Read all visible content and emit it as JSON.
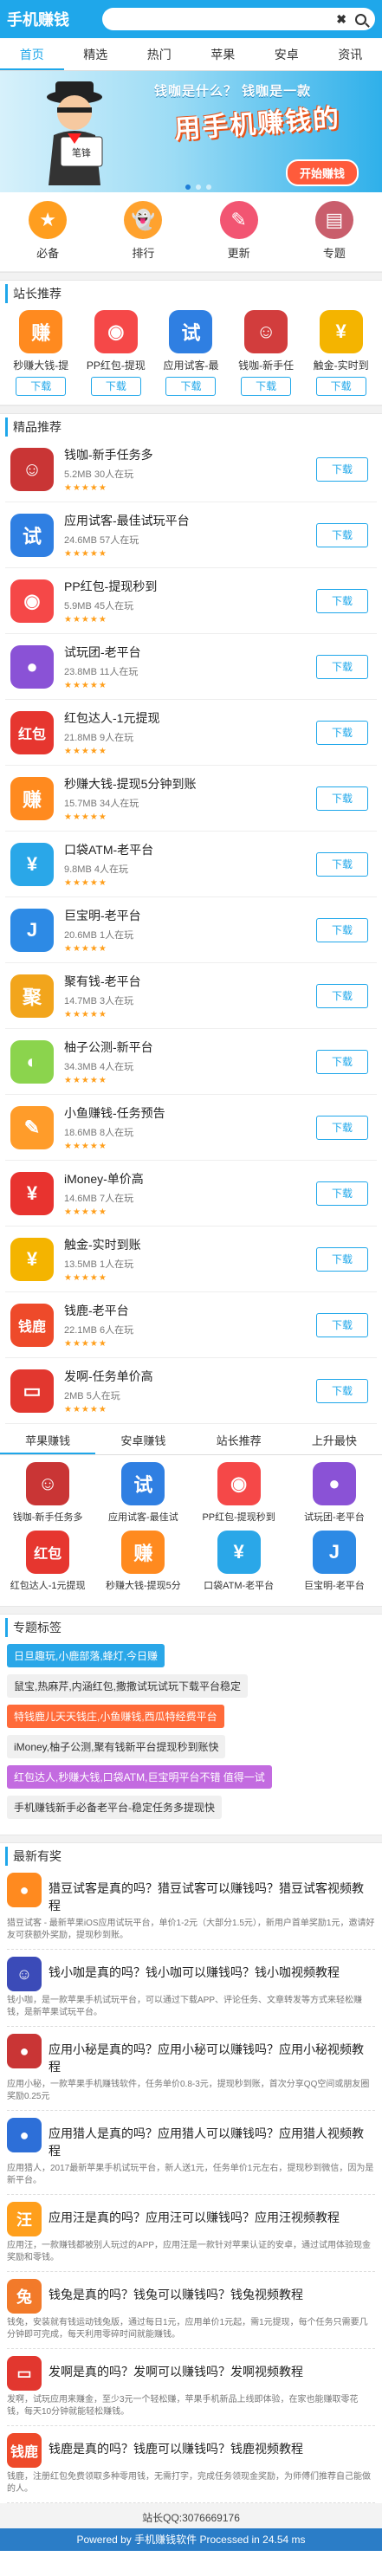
{
  "header": {
    "title": "手机赚钱",
    "search_placeholder": "",
    "clear_glyph": "✖"
  },
  "nav": [
    "首页",
    "精选",
    "热门",
    "苹果",
    "安卓",
    "资讯"
  ],
  "banner": {
    "question": "钱咖是什么？ 钱咖是一款",
    "headline": "用手机赚钱的",
    "button": "开始赚钱",
    "man_label": "笔锋"
  },
  "quick": [
    {
      "label": "必备",
      "icon": "star-icon",
      "color": "#ff9e1f",
      "glyph": "★"
    },
    {
      "label": "排行",
      "icon": "ghost-icon",
      "color": "#ffa22e",
      "glyph": "👻"
    },
    {
      "label": "更新",
      "icon": "edit-icon",
      "color": "#f25572",
      "glyph": "✎"
    },
    {
      "label": "专题",
      "icon": "folder-icon",
      "color": "#c95e6c",
      "glyph": "▤"
    }
  ],
  "recommend": {
    "title": "站长推荐",
    "download": "下载",
    "items": [
      {
        "name": "秒赚大钱-提",
        "glyph": "赚",
        "color": "#ff8a1f"
      },
      {
        "name": "PP红包-提现",
        "glyph": "◉",
        "color": "#f54848"
      },
      {
        "name": "应用试客-最",
        "glyph": "试",
        "color": "#2f7fe2"
      },
      {
        "name": "钱咖-新手任",
        "glyph": "☺",
        "color": "#d23d3d"
      },
      {
        "name": "触金-实时到",
        "glyph": "¥",
        "color": "#f4b400"
      }
    ]
  },
  "selected": {
    "title": "精品推荐",
    "download": "下载",
    "stars": "★★★★★",
    "items": [
      {
        "name": "钱咖-新手任务多",
        "size": "5.2MB",
        "users": "30人在玩",
        "glyph": "☺",
        "color": "#c93535"
      },
      {
        "name": "应用试客-最佳试玩平台",
        "size": "24.6MB",
        "users": "57人在玩",
        "glyph": "试",
        "color": "#2f7fe2"
      },
      {
        "name": "PP红包-提现秒到",
        "size": "5.9MB",
        "users": "45人在玩",
        "glyph": "◉",
        "color": "#f54848"
      },
      {
        "name": "试玩团-老平台",
        "size": "23.8MB",
        "users": "11人在玩",
        "glyph": "●",
        "color": "#8a52d6"
      },
      {
        "name": "红包达人-1元提现",
        "size": "21.8MB",
        "users": "9人在玩",
        "glyph": "红包",
        "color": "#e6362f"
      },
      {
        "name": "秒赚大钱-提现5分钟到账",
        "size": "15.7MB",
        "users": "34人在玩",
        "glyph": "赚",
        "color": "#ff8a1f"
      },
      {
        "name": "口袋ATM-老平台",
        "size": "9.8MB",
        "users": "4人在玩",
        "glyph": "¥",
        "color": "#2aa7e8"
      },
      {
        "name": "巨宝明-老平台",
        "size": "20.6MB",
        "users": "1人在玩",
        "glyph": "J",
        "color": "#2d8ae5"
      },
      {
        "name": "聚有钱-老平台",
        "size": "14.7MB",
        "users": "3人在玩",
        "glyph": "聚",
        "color": "#f2a51c"
      },
      {
        "name": "柚子公测-新平台",
        "size": "34.3MB",
        "users": "4人在玩",
        "glyph": "◐",
        "color": "#8bd44d"
      },
      {
        "name": "小鱼赚钱-任务预告",
        "size": "18.6MB",
        "users": "8人在玩",
        "glyph": "✎",
        "color": "#ff9c2a"
      },
      {
        "name": "iMoney-单价高",
        "size": "14.6MB",
        "users": "7人在玩",
        "glyph": "¥",
        "color": "#e8332f"
      },
      {
        "name": "触金-实时到账",
        "size": "13.5MB",
        "users": "1人在玩",
        "glyph": "¥",
        "color": "#f4b400"
      },
      {
        "name": "钱鹿-老平台",
        "size": "22.1MB",
        "users": "6人在玩",
        "glyph": "钱鹿",
        "color": "#ee4a2a"
      },
      {
        "name": "发啊-任务单价高",
        "size": "2MB",
        "users": "5人在玩",
        "glyph": "▭",
        "color": "#e2372f"
      }
    ]
  },
  "tabs": [
    "苹果赚钱",
    "安卓赚钱",
    "站长推荐",
    "上升最快"
  ],
  "tab_items": [
    {
      "name": "钱咖-新手任务多",
      "glyph": "☺",
      "color": "#c93535"
    },
    {
      "name": "应用试客-最佳试",
      "glyph": "试",
      "color": "#2f7fe2"
    },
    {
      "name": "PP红包-提现秒到",
      "glyph": "◉",
      "color": "#f54848"
    },
    {
      "name": "试玩团-老平台",
      "glyph": "●",
      "color": "#8a52d6"
    },
    {
      "name": "红包达人-1元提现",
      "glyph": "红包",
      "color": "#e6362f"
    },
    {
      "name": "秒赚大钱-提现5分",
      "glyph": "赚",
      "color": "#ff8a1f"
    },
    {
      "name": "口袋ATM-老平台",
      "glyph": "¥",
      "color": "#2aa7e8"
    },
    {
      "name": "巨宝明-老平台",
      "glyph": "J",
      "color": "#2d8ae5"
    }
  ],
  "topics": {
    "title": "专题标签",
    "lines": [
      [
        {
          "text": "日旦趣玩,小鹿部落,蜂灯,今日赚",
          "color": "#2aa7e8"
        }
      ],
      [
        {
          "text": "鼠宝,热麻芹,内涵红包,撒撒试玩试玩下载平台稳定",
          "color": "g"
        }
      ],
      [
        {
          "text": "特钱鹿儿天天钱庄,小鱼赚钱,西瓜特经费平台",
          "color": "#ff6b3a"
        }
      ],
      [
        {
          "text": "iMoney,柚子公测,聚有钱新平台提现秒到账快",
          "color": "g"
        }
      ],
      [
        {
          "text": "红包达人,秒赚大钱,口袋ATM,巨宝明平台不错 值得一试",
          "color": "#c36be0"
        }
      ],
      [
        {
          "text": "手机赚钱新手必备老平台-稳定任务多提现快",
          "color": "g"
        }
      ]
    ]
  },
  "news": {
    "title": "最新有奖",
    "items": [
      {
        "title": "猎豆试客是真的吗？猎豆试客可以赚钱吗？猎豆试客视频教程",
        "desc": "猎豆试客 - 最新苹果iOS应用试玩平台，单价1-2元（大部分1.5元），新用户首单奖励1元，邀请好友可获额外奖励，提现秒到账。",
        "glyph": "●",
        "color": "#ff8a1f"
      },
      {
        "title": "钱小咖是真的吗？钱小咖可以赚钱吗？钱小咖视频教程",
        "desc": "钱小咖，是一款苹果手机试玩平台，可以通过下载APP、评论任务、文章转发等方式来轻松赚钱，是新苹果试玩平台。",
        "glyph": "☺",
        "color": "#3b4bb8"
      },
      {
        "title": "应用小秘是真的吗？应用小秘可以赚钱吗？应用小秘视频教程",
        "desc": "应用小秘，一款苹果手机赚钱软件，任务单价0.8-3元，提现秒到账，首次分享QQ空间或朋友圈奖励0.25元",
        "glyph": "●",
        "color": "#c93535"
      },
      {
        "title": "应用猎人是真的吗？应用猎人可以赚钱吗？应用猎人视频教程",
        "desc": "应用猎人，2017最新苹果手机试玩平台，新人送1元，任务单价1元左右，提现秒到微信，因为是新平台。",
        "glyph": "●",
        "color": "#2d6fd8"
      },
      {
        "title": "应用汪是真的吗？应用汪可以赚钱吗？应用汪视频教程",
        "desc": "应用汪，一款赚钱都被别人玩过的APP，应用汪是一款针对苹果认证的安卓，通过试用体验现金奖励和零钱。",
        "glyph": "汪",
        "color": "#ff9f1c"
      },
      {
        "title": "钱兔是真的吗？钱兔可以赚钱吗？钱兔视频教程",
        "desc": "钱兔，安装就有钱运动钱兔版，通过每日1元，应用单价1元起，需1元提现，每个任务只需要几分钟即可完成，每天利用零碎时间就能赚钱。",
        "glyph": "兔",
        "color": "#f27a2a"
      },
      {
        "title": "发啊是真的吗？发啊可以赚钱吗？发啊视频教程",
        "desc": "发啊，试玩应用来赚金，至少3元一个轻松赚，苹果手机新品上线即体验，在家也能赚取零花钱，每天10分钟就能轻松赚钱。",
        "glyph": "▭",
        "color": "#e2372f"
      },
      {
        "title": "钱鹿是真的吗？钱鹿可以赚钱吗？钱鹿视频教程",
        "desc": "钱鹿，注册红包免费领取多种零用钱，无需打字，完成任务领现金奖励，为师傅们推荐自己能做的人。",
        "glyph": "钱鹿",
        "color": "#ee4a2a"
      }
    ]
  },
  "footer": {
    "contact": "站长QQ:3076669176",
    "powered": "Powered  by  手机赚钱软件  Processed in 24.54 ms"
  }
}
